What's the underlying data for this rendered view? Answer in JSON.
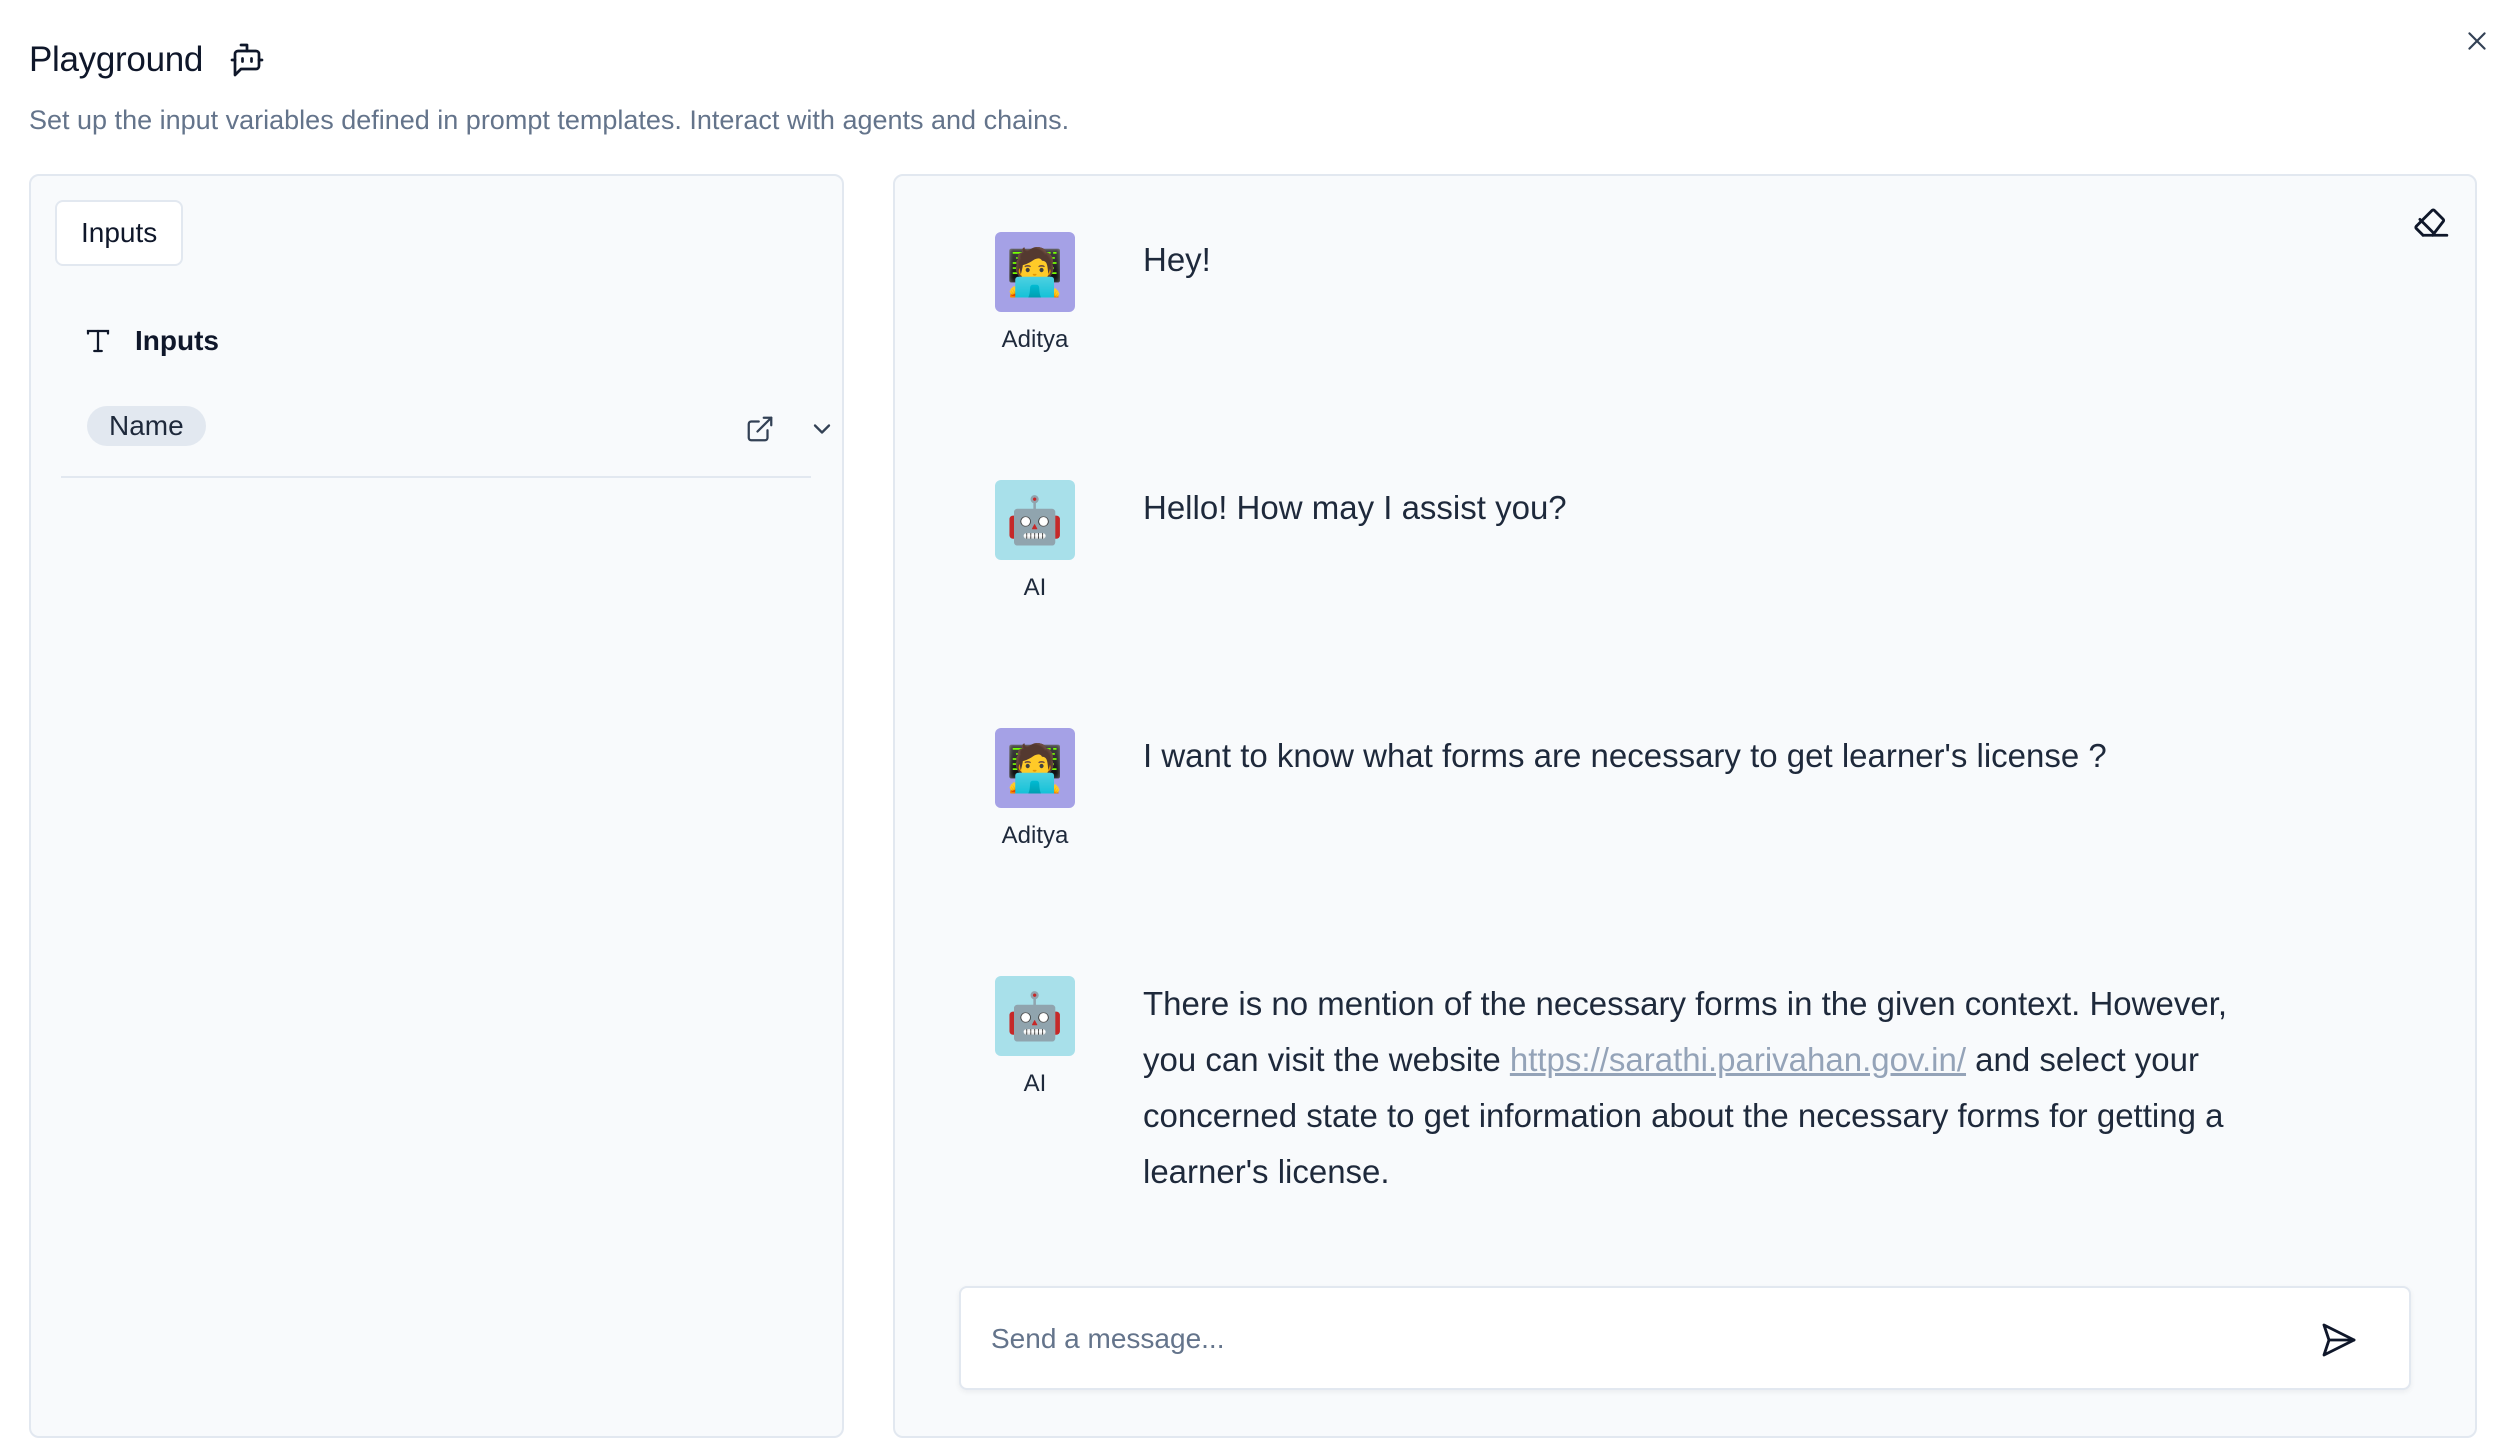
{
  "header": {
    "title": "Playground",
    "subtitle": "Set up the input variables defined in prompt templates. Interact with agents and chains."
  },
  "left_panel": {
    "tab_label": "Inputs",
    "section_label": "Inputs",
    "variables": [
      {
        "name": "Name"
      }
    ]
  },
  "chat": {
    "messages": [
      {
        "author": "Aditya",
        "role": "user",
        "text": "Hey!"
      },
      {
        "author": "AI",
        "role": "ai",
        "text": "Hello! How may I assist you?"
      },
      {
        "author": "Aditya",
        "role": "user",
        "text": "I want to know what forms are necessary to get learner's license ?"
      },
      {
        "author": "AI",
        "role": "ai",
        "text_before": "There is no mention of the necessary forms in the given context. However, you can visit the website ",
        "link": "https://sarathi.parivahan.gov.in/",
        "text_after": " and select your concerned state to get information about the necessary forms for getting a learner's license."
      }
    ],
    "input_placeholder": "Send a message..."
  },
  "icons": {
    "title_icon": "bot-message-icon",
    "close": "close-icon",
    "text_type": "text-type-icon",
    "external_link": "external-link-icon",
    "chevron": "chevron-down-icon",
    "eraser": "eraser-icon",
    "send": "send-icon",
    "user_avatar": "technologist-emoji",
    "ai_avatar": "robot-emoji"
  },
  "colors": {
    "user_avatar_bg": "#a5a1e6",
    "ai_avatar_bg": "#a8e0ea",
    "panel_bg": "#f8fafc",
    "border": "#e2e8f0",
    "link": "#94a3b8"
  }
}
